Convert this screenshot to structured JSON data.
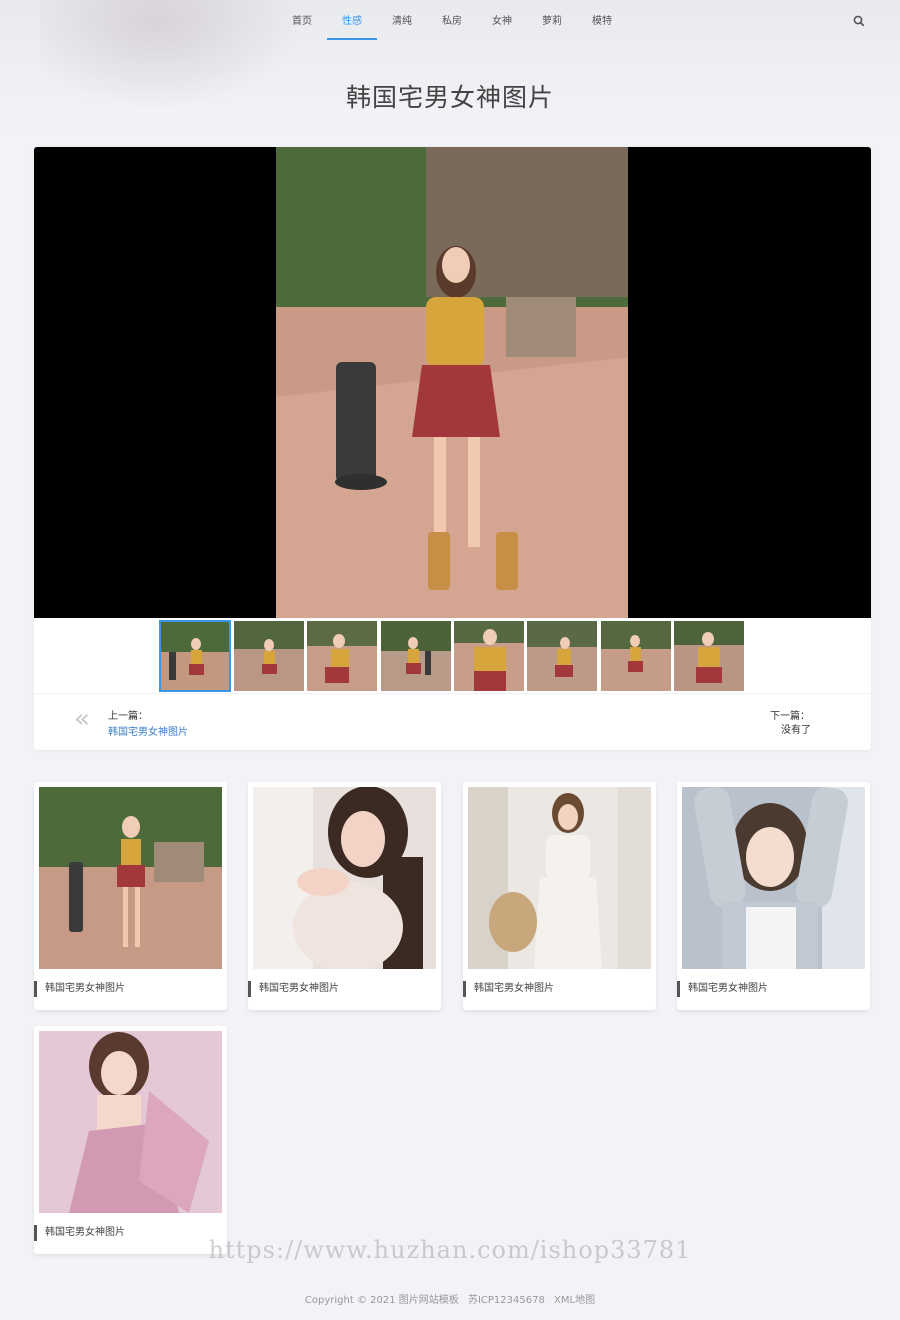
{
  "nav": {
    "items": [
      {
        "label": "首页",
        "active": false
      },
      {
        "label": "性感",
        "active": true
      },
      {
        "label": "清纯",
        "active": false
      },
      {
        "label": "私房",
        "active": false
      },
      {
        "label": "女神",
        "active": false
      },
      {
        "label": "萝莉",
        "active": false
      },
      {
        "label": "模特",
        "active": false
      }
    ],
    "search_icon": "search-icon",
    "accent_color": "#3a96e6"
  },
  "page_title": "韩国宅男女神图片",
  "gallery": {
    "thumbnail_count": 8,
    "selected_index": 0
  },
  "pager": {
    "prev_label": "上一篇：",
    "prev_link": "韩国宅男女神图片",
    "next_label": "下一篇：",
    "next_value": "没有了",
    "prev_icon": "double-chevron-left-icon"
  },
  "related": [
    {
      "caption": "韩国宅男女神图片"
    },
    {
      "caption": "韩国宅男女神图片"
    },
    {
      "caption": "韩国宅男女神图片"
    },
    {
      "caption": "韩国宅男女神图片"
    },
    {
      "caption": "韩国宅男女神图片"
    }
  ],
  "watermark": "https://www.huzhan.com/ishop33781",
  "footer": {
    "copyright": "Copyright © 2021 图片网站模板",
    "icp": "苏ICP12345678",
    "sitemap": "XML地图"
  }
}
